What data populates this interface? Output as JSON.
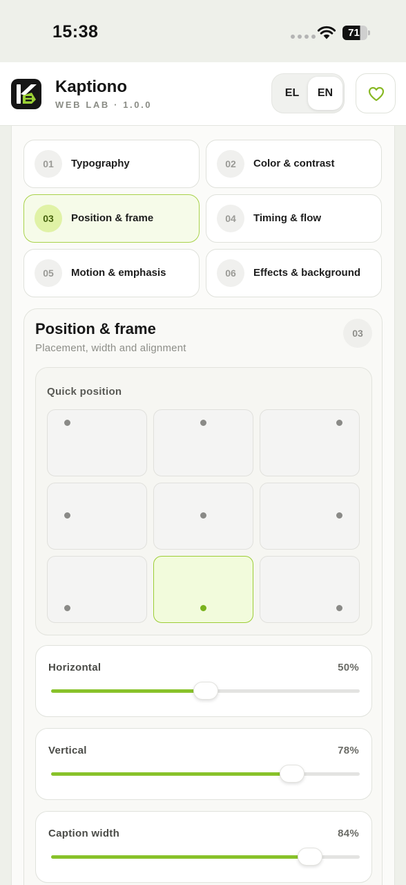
{
  "status_bar": {
    "time": "15:38",
    "battery": "71"
  },
  "header": {
    "app_name": "Kaptiono",
    "app_subtitle": "WEB LAB · 1.0.0",
    "languages": [
      "EL",
      "EN"
    ],
    "active_language": "EN",
    "accent_color": "#88c22a"
  },
  "tabs": [
    {
      "num": "01",
      "label": "Typography",
      "active": false
    },
    {
      "num": "02",
      "label": "Color & contrast",
      "active": false
    },
    {
      "num": "03",
      "label": "Position & frame",
      "active": true
    },
    {
      "num": "04",
      "label": "Timing & flow",
      "active": false
    },
    {
      "num": "05",
      "label": "Motion & emphasis",
      "active": false
    },
    {
      "num": "06",
      "label": "Effects & background",
      "active": false
    }
  ],
  "section": {
    "title": "Position & frame",
    "subtitle": "Placement, width and alignment",
    "badge": "03",
    "quick_position": {
      "label": "Quick position",
      "options": [
        "top-left",
        "top-center",
        "top-right",
        "middle-left",
        "center",
        "middle-right",
        "bottom-left",
        "bottom-center",
        "bottom-right"
      ],
      "selected": "bottom-center"
    },
    "sliders": [
      {
        "label": "Horizontal",
        "value_text": "50%",
        "value": 0.5
      },
      {
        "label": "Vertical",
        "value_text": "78%",
        "value": 0.78
      },
      {
        "label": "Caption width",
        "value_text": "84%",
        "value": 0.84
      }
    ]
  }
}
